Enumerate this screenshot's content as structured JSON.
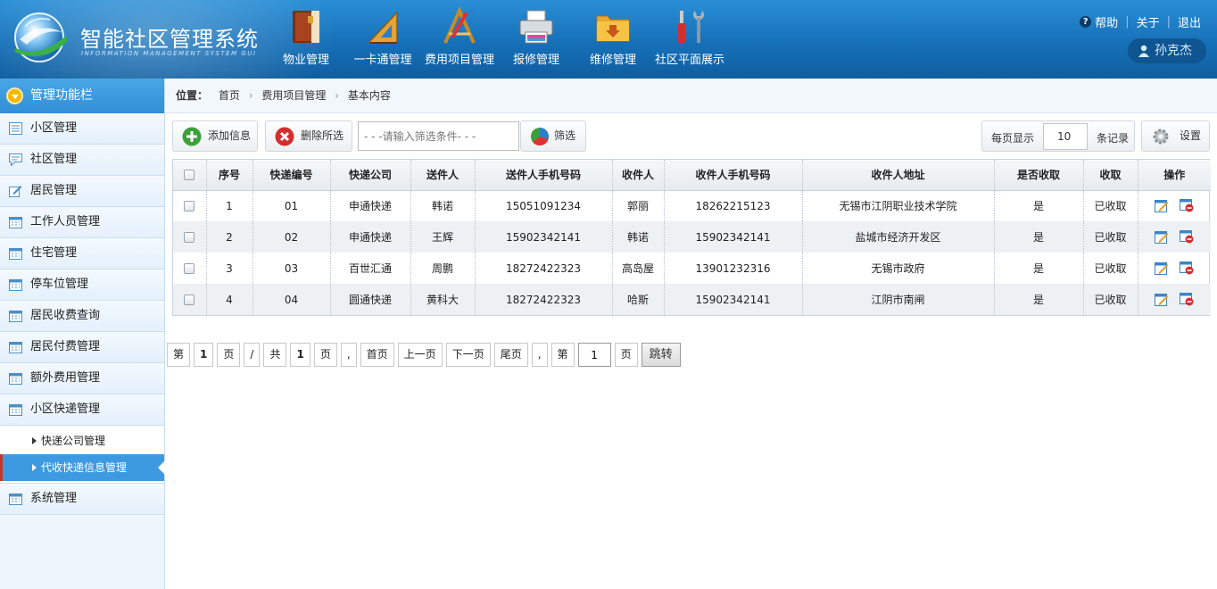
{
  "app": {
    "title": "智能社区管理系统",
    "subtitle": "INFORMATION MANAGEMENT SYSTEM GUI"
  },
  "topnav": [
    {
      "label": "物业管理",
      "icon": "book-icon"
    },
    {
      "label": "一卡通管理",
      "icon": "ruler-triangle-icon"
    },
    {
      "label": "费用项目管理",
      "icon": "design-tools-icon"
    },
    {
      "label": "报修管理",
      "icon": "printer-icon"
    },
    {
      "label": "维修管理",
      "icon": "download-folder-icon"
    },
    {
      "label": "社区平面展示",
      "icon": "tools-icon"
    }
  ],
  "toplinks": {
    "help": "帮助",
    "about": "关于",
    "logout": "退出",
    "help_mark": "?"
  },
  "user": {
    "name": "孙克杰"
  },
  "sidebar": {
    "title": "管理功能栏",
    "items": [
      {
        "label": "小区管理"
      },
      {
        "label": "社区管理"
      },
      {
        "label": "居民管理"
      },
      {
        "label": "工作人员管理"
      },
      {
        "label": "住宅管理"
      },
      {
        "label": "停车位管理"
      },
      {
        "label": "居民收费查询"
      },
      {
        "label": "居民付费管理"
      },
      {
        "label": "额外费用管理"
      },
      {
        "label": "小区快递管理"
      }
    ],
    "subitems": [
      {
        "label": "快递公司管理"
      },
      {
        "label": "代收快递信息管理"
      }
    ],
    "last": {
      "label": "系统管理"
    }
  },
  "breadcrumb": {
    "prefix": "位置：",
    "items": [
      "首页",
      "费用项目管理",
      "基本内容"
    ]
  },
  "toolbar": {
    "add_label": "添加信息",
    "delete_label": "删除所选",
    "filter_placeholder": "- - -请输入筛选条件- - -",
    "filter_label": "筛选",
    "perpage_label": "每页显示",
    "perpage_value": "10",
    "records_label": "条记录",
    "settings_label": "设置"
  },
  "table": {
    "headers": [
      "序号",
      "快递编号",
      "快递公司",
      "送件人",
      "送件人手机号码",
      "收件人",
      "收件人手机号码",
      "收件人地址",
      "是否收取",
      "收取",
      "操作"
    ],
    "rows": [
      [
        "1",
        "01",
        "申通快递",
        "韩诺",
        "15051091234",
        "郭丽",
        "18262215123",
        "无锡市江阴职业技术学院",
        "是",
        "已收取"
      ],
      [
        "2",
        "02",
        "申通快递",
        "王辉",
        "15902342141",
        "韩诺",
        "15902342141",
        "盐城市经济开发区",
        "是",
        "已收取"
      ],
      [
        "3",
        "03",
        "百世汇通",
        "周鹏",
        "18272422323",
        "高岛屋",
        "13901232316",
        "无锡市政府",
        "是",
        "已收取"
      ],
      [
        "4",
        "04",
        "圆通快递",
        "黄科大",
        "18272422323",
        "哈斯",
        "15902342141",
        "江阴市南闸",
        "是",
        "已收取"
      ]
    ]
  },
  "pager": {
    "di": "第",
    "current": "1",
    "ye": "页",
    "slash": "/",
    "gong": "共",
    "total": "1",
    "ye2": "页",
    "comma": ",",
    "first": "首页",
    "prev": "上一页",
    "next": "下一页",
    "last": "尾页",
    "comma2": ",",
    "di2": "第",
    "jump_value": "1",
    "ye3": "页",
    "go": "跳转"
  },
  "colors": {
    "header_blue": "#1670b8",
    "sidebar_active": "#3d9ae0",
    "accent_red": "#c0392b"
  }
}
